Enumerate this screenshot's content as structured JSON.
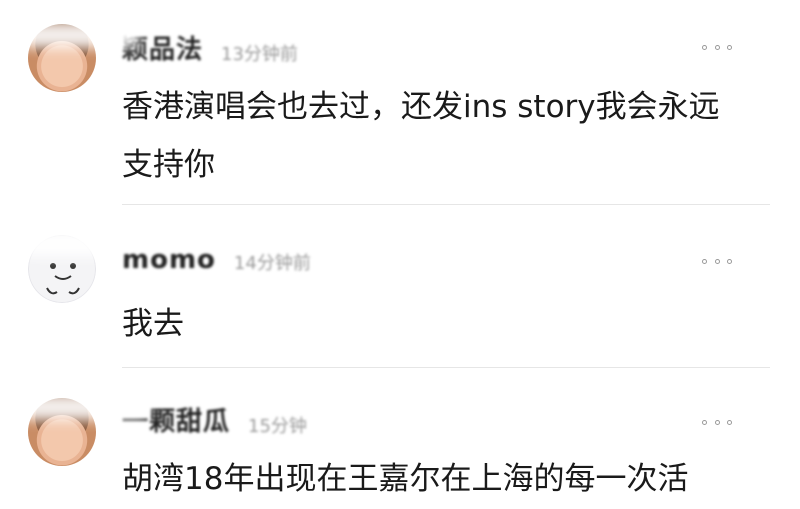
{
  "comments": [
    {
      "name": "颖品法",
      "meta": "13分钟前",
      "text_line1": "香港演唱会也去过，还发ins story我会永远",
      "text_line2": "支持你"
    },
    {
      "name": "momo",
      "meta": "14分钟前",
      "text_line1": "我去"
    },
    {
      "name": "一颗甜瓜",
      "meta": "15分钟",
      "text_line1": "胡湾18年出现在王嘉尔在上海的每一次活"
    }
  ],
  "icons": {
    "more": "more-options-icon"
  }
}
